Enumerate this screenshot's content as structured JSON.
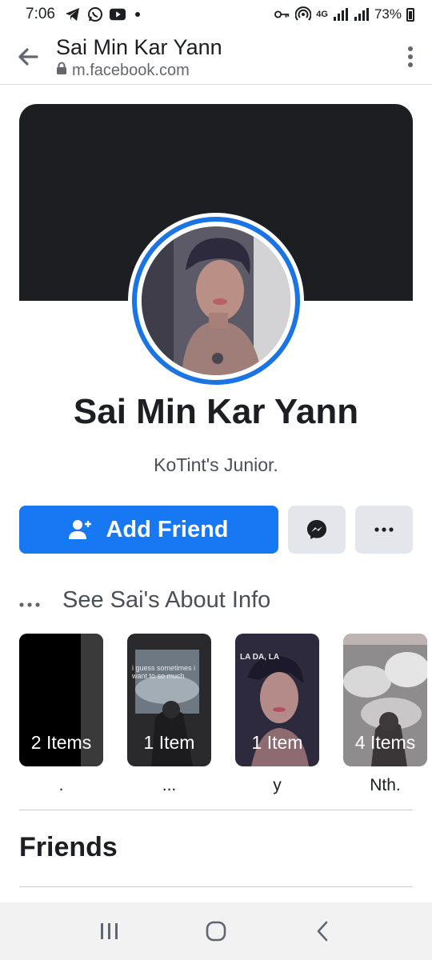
{
  "status_bar": {
    "time": "7:06",
    "network": "4G",
    "battery": "73%"
  },
  "browser": {
    "title": "Sai Min Kar Yann",
    "url": "m.facebook.com"
  },
  "profile": {
    "name": "Sai Min Kar Yann",
    "bio": "KoTint's Junior."
  },
  "actions": {
    "add_friend_label": "Add Friend"
  },
  "about": {
    "label": "See Sai's About Info"
  },
  "highlights": [
    {
      "count": "2 Items",
      "label": "."
    },
    {
      "count": "1 Item",
      "label": "...",
      "overlay_text": "i guess sometimes i want to so much"
    },
    {
      "count": "1 Item",
      "label": "y",
      "overlay_text": "LA DA, LA"
    },
    {
      "count": "4 Items",
      "label": "Nth."
    }
  ],
  "friends": {
    "title": "Friends"
  },
  "colors": {
    "brand_blue": "#1877f2",
    "avatar_ring": "#1b74e4",
    "cover": "#1c1e21"
  }
}
